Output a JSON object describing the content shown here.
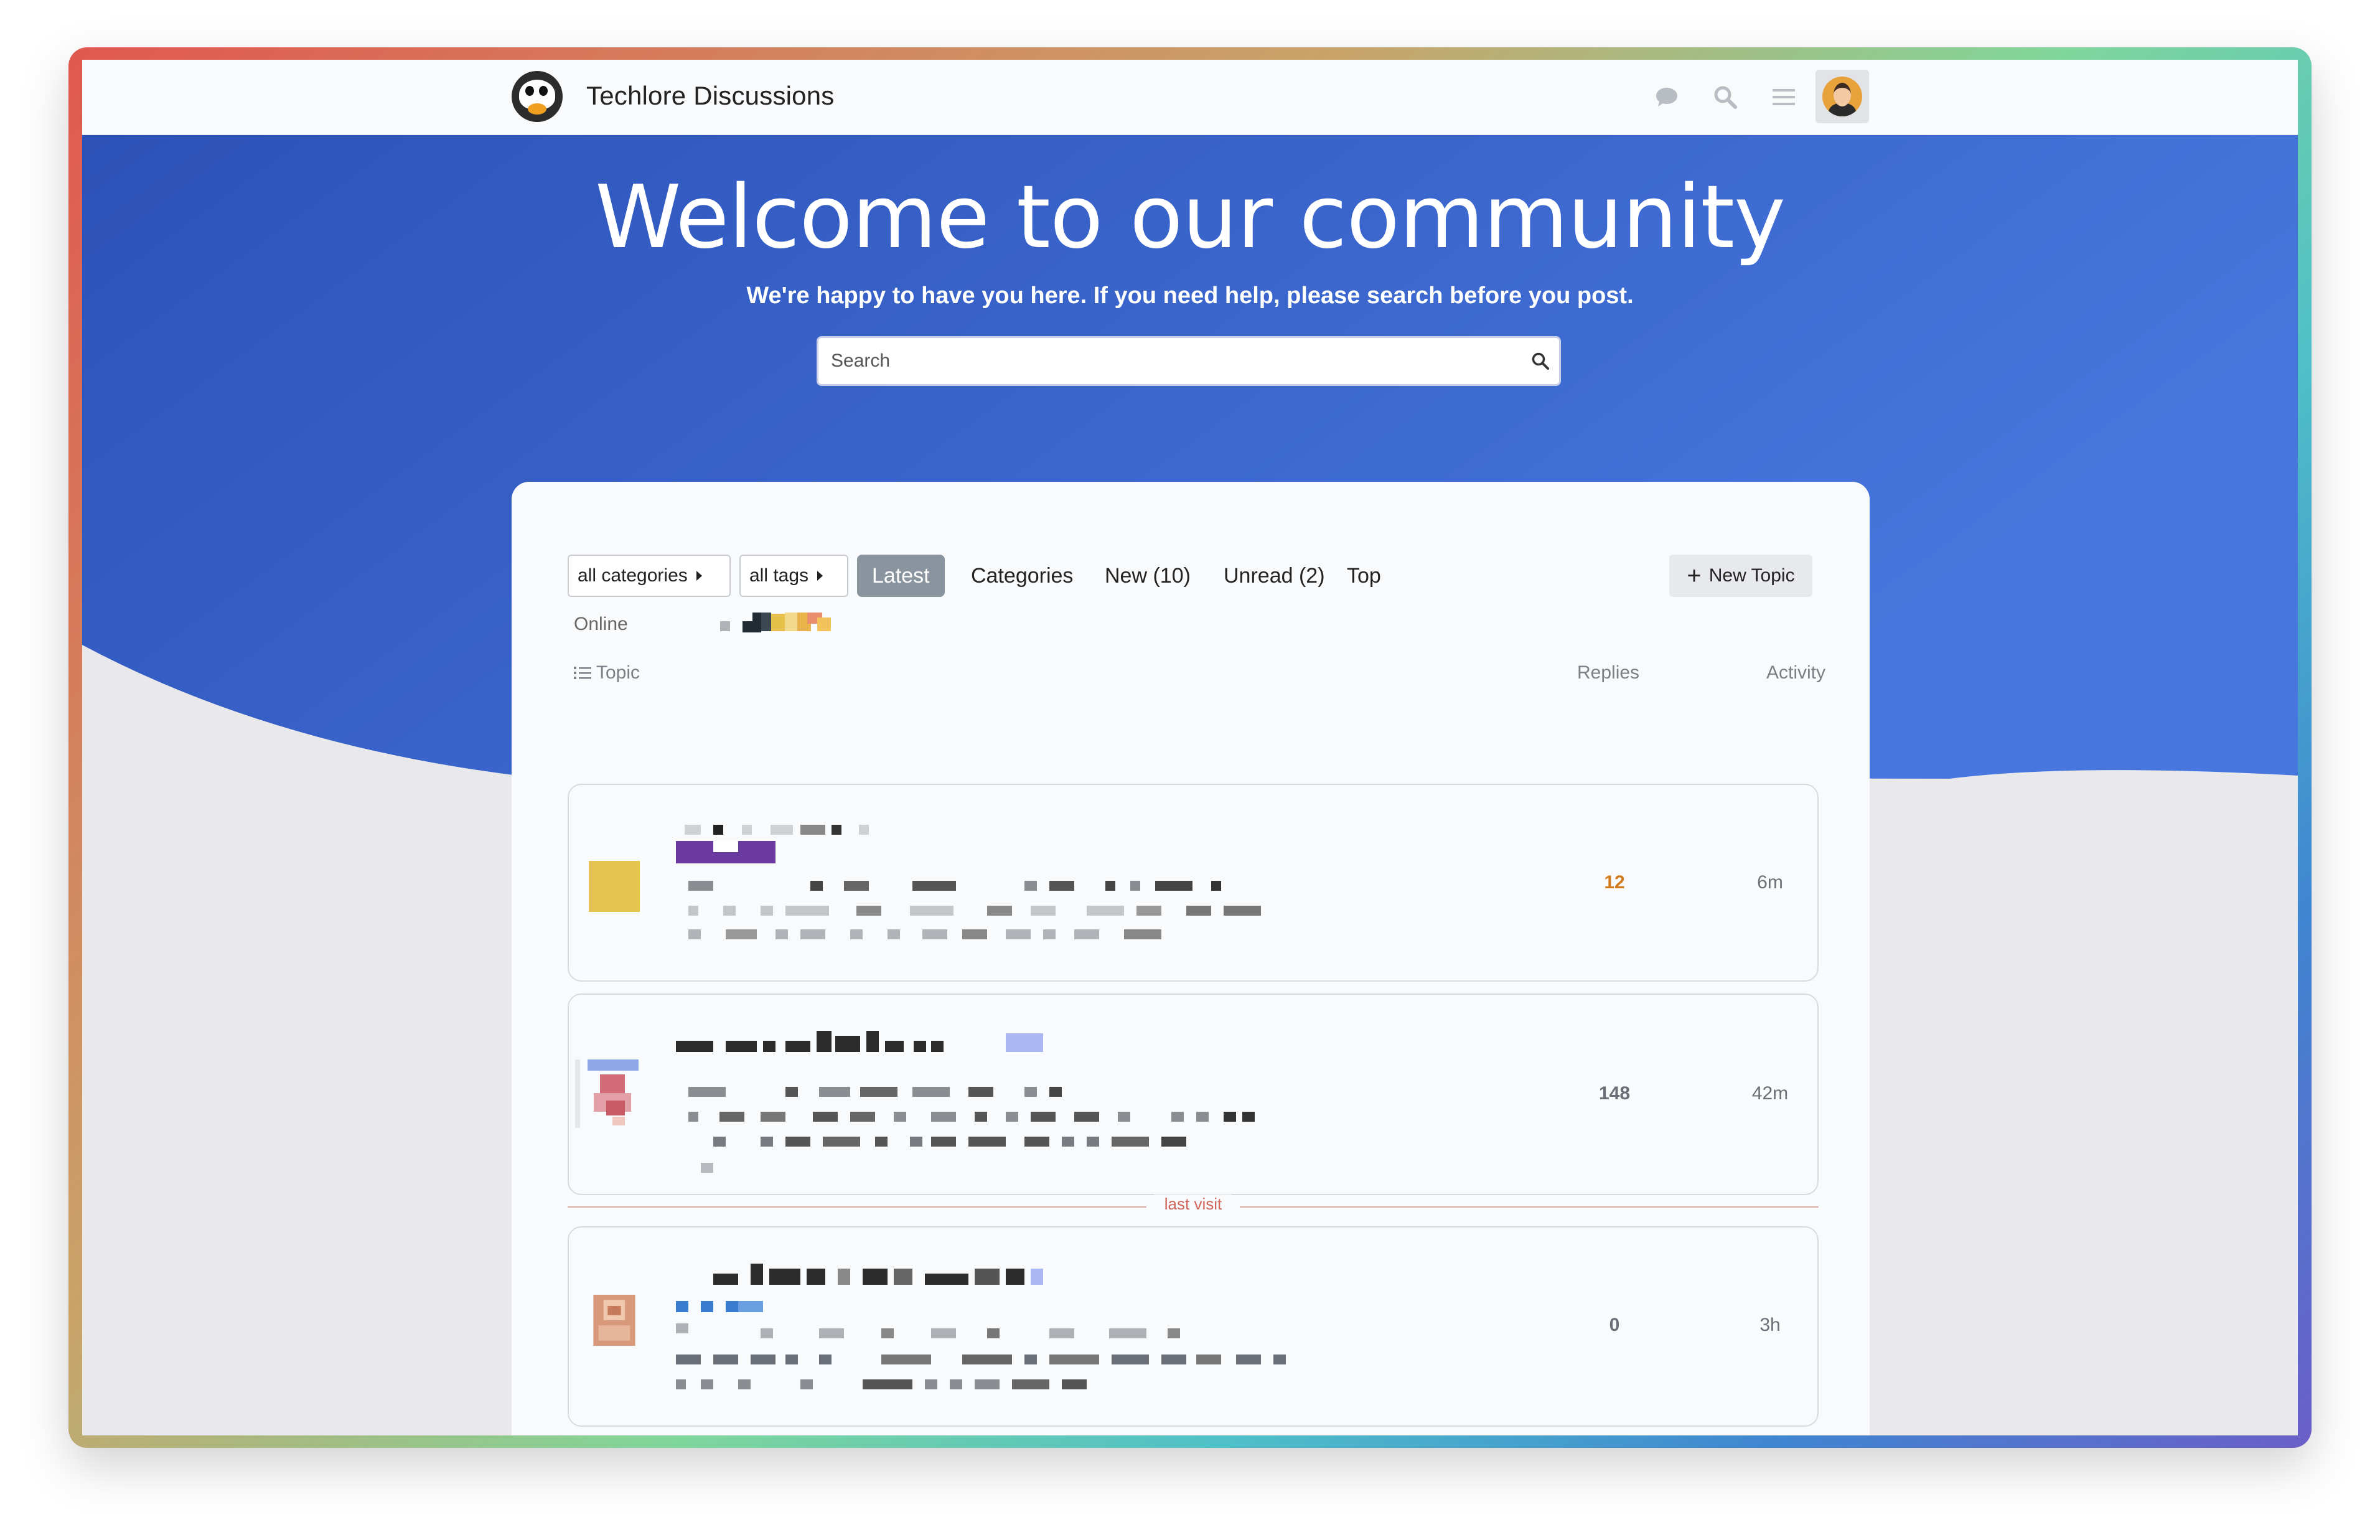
{
  "site": {
    "name": "Techlore Discussions"
  },
  "header": {
    "icons": [
      "chat-icon",
      "search-icon",
      "hamburger-menu-icon",
      "user-avatar"
    ]
  },
  "hero": {
    "title": "Welcome to our community",
    "subtitle": "We're happy to have you here. If you need help, please search before you post.",
    "search_placeholder": "Search"
  },
  "filters": {
    "category": "all categories",
    "tags": "all tags"
  },
  "nav": [
    {
      "label": "Latest",
      "active": true
    },
    {
      "label": "Categories",
      "active": false
    },
    {
      "label": "New (10)",
      "active": false
    },
    {
      "label": "Unread (2)",
      "active": false
    },
    {
      "label": "Top",
      "active": false
    }
  ],
  "new_topic_label": "New Topic",
  "online_label": "Online",
  "table": {
    "col_topic": "Topic",
    "col_replies": "Replies",
    "col_activity": "Activity"
  },
  "topics": [
    {
      "replies": "12",
      "activity": "6m",
      "hot": true,
      "thumb_color": "#e7c350"
    },
    {
      "replies": "148",
      "activity": "42m",
      "hot": false,
      "thumb_color": "#d9888a"
    },
    {
      "replies": "0",
      "activity": "3h",
      "hot": false,
      "thumb_color": "#d8997a"
    }
  ],
  "last_visit_label": "last visit",
  "colors": {
    "hero_start": "#2c52b8",
    "hero_end": "#4777de",
    "accent_hot": "#d07a1c",
    "active_pill": "#8a949e"
  }
}
